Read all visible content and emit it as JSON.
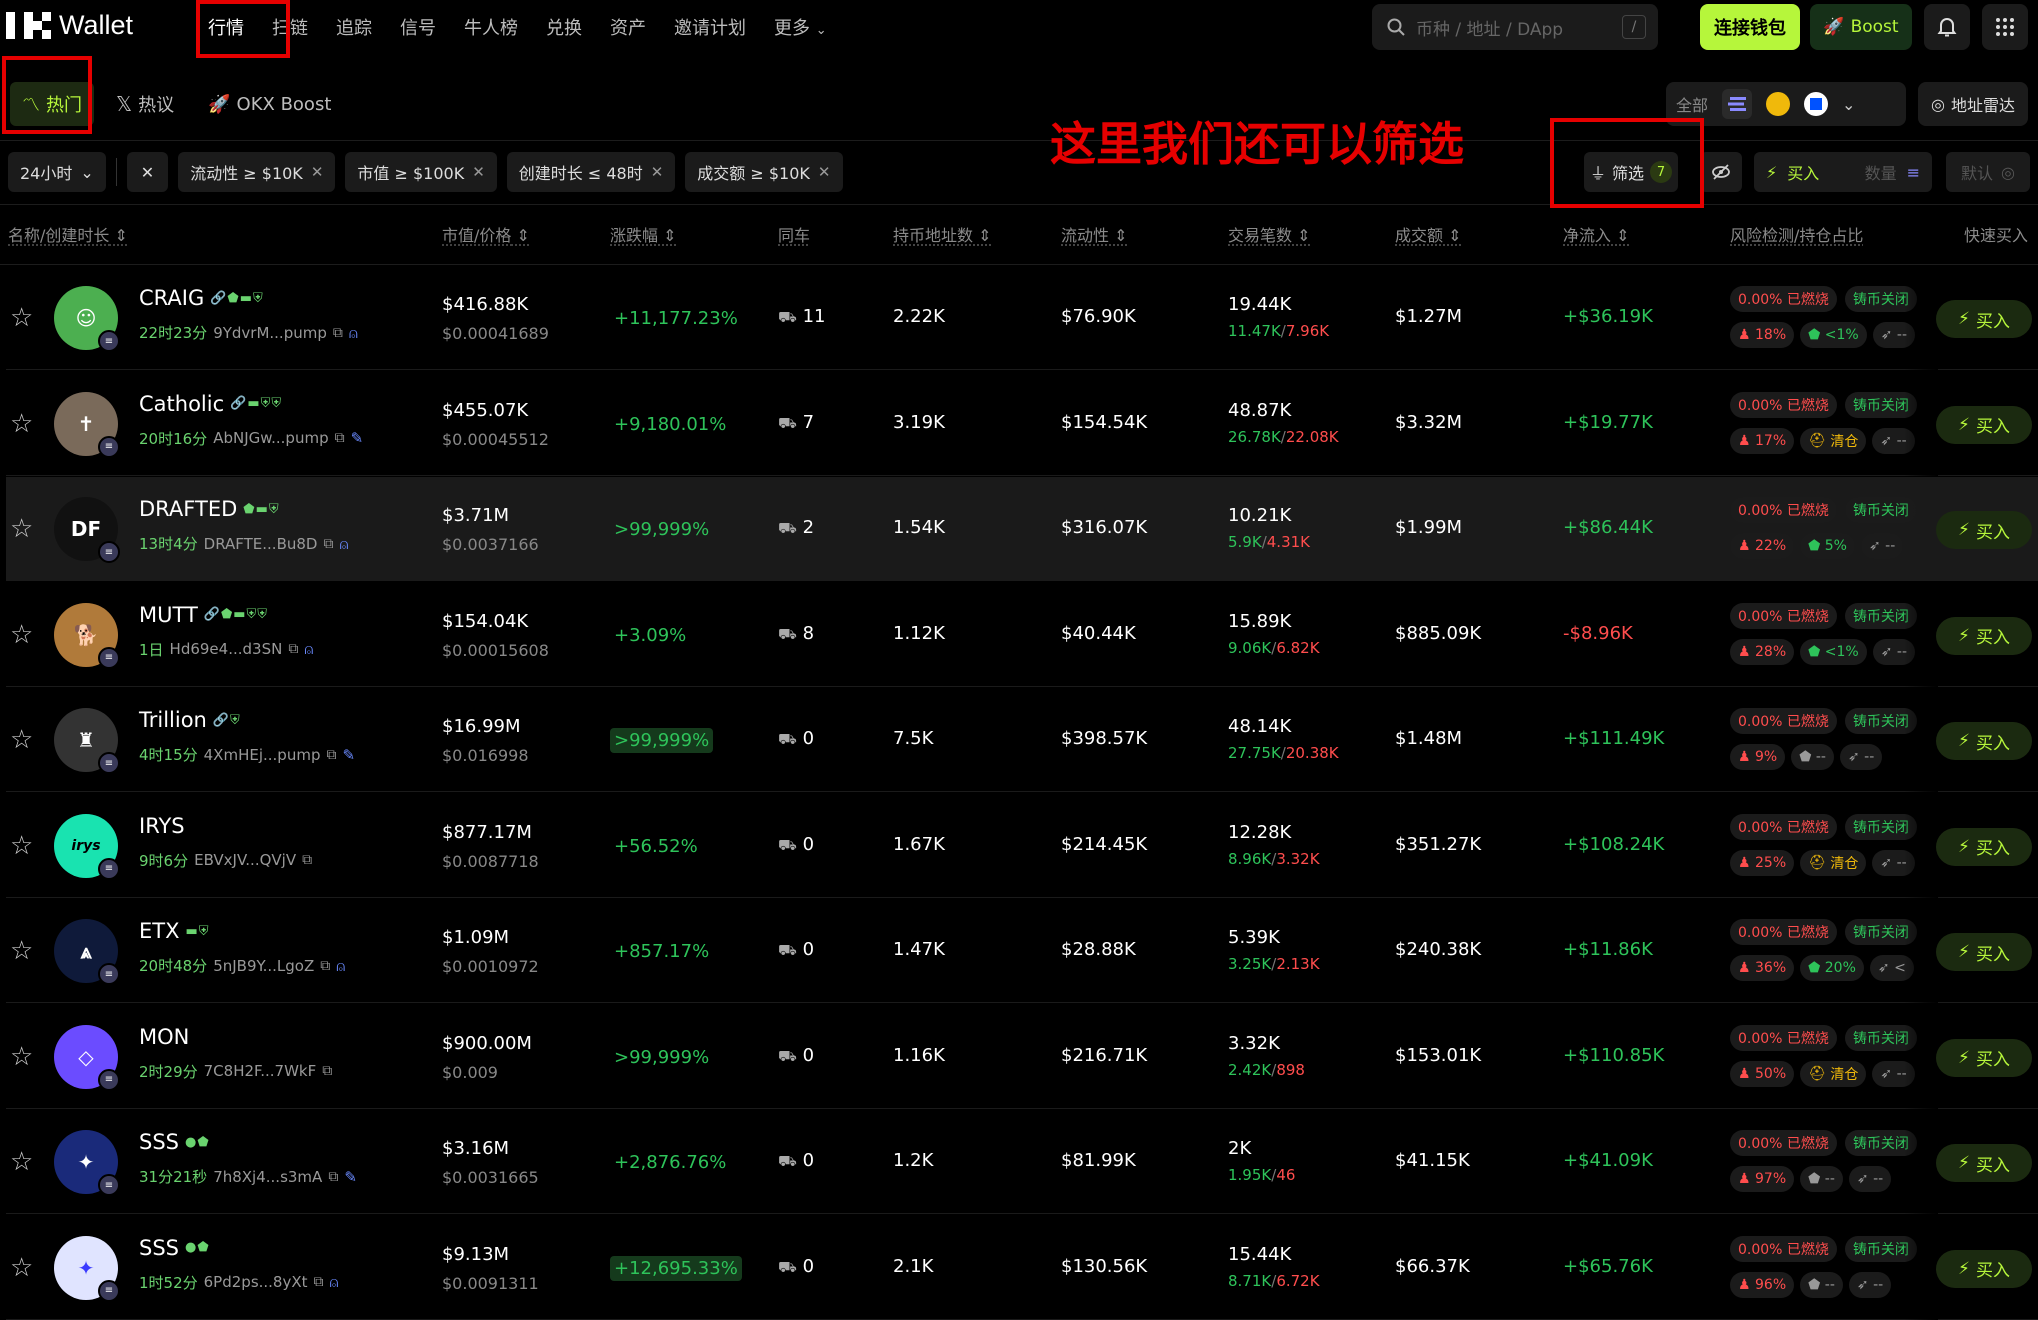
{
  "brand": {
    "wallet_label": "Wallet"
  },
  "nav": {
    "items": [
      "行情",
      "扫链",
      "追踪",
      "信号",
      "牛人榜",
      "兑换",
      "资产",
      "邀请计划",
      "更多"
    ],
    "more_icon": "chevron-down-icon"
  },
  "search": {
    "placeholder": "币种 / 地址 / DApp",
    "shortcut": "/"
  },
  "header_buttons": {
    "connect": "连接钱包",
    "boost": "Boost"
  },
  "subtabs": [
    {
      "label": "热门",
      "icon": "chart-icon"
    },
    {
      "label": "热议",
      "icon": "x-logo-icon"
    },
    {
      "label": "OKX Boost",
      "icon": "rocket-icon"
    }
  ],
  "chain_filter": {
    "all": "全部"
  },
  "radar": {
    "label": "地址雷达"
  },
  "annotation": "这里我们还可以筛选",
  "filters": {
    "timeframe": "24小时",
    "chips": [
      "流动性 ≥ $10K",
      "市值 ≥ $100K",
      "创建时长 ≤ 48时",
      "成交额 ≥ $10K"
    ],
    "filter_label": "筛选",
    "filter_count": "7",
    "quick_buy": "买入",
    "amount_placeholder": "数量",
    "default_label": "默认"
  },
  "columns": {
    "name": "名称/创建时长",
    "mcap": "市值/价格",
    "change": "涨跌幅",
    "same_car": "同车",
    "holders": "持币地址数",
    "liquidity": "流动性",
    "txs": "交易笔数",
    "volume": "成交额",
    "netflow": "净流入",
    "risk": "风险检测/持仓占比",
    "quickbuy": "快速买入"
  },
  "colors": {
    "accent": "#b6f63b",
    "up": "#2ec35a",
    "down": "#ff4d4d",
    "annotation": "#e60000"
  },
  "rows": [
    {
      "name": "CRAIG",
      "tags": "🔗⬟▬⛨",
      "age": "22时23分",
      "addr": "9YdvrM...pump",
      "social": "person-icon",
      "mcap": "$416.88K",
      "price": "$0.00041689",
      "change": "+11,177.23%",
      "same": "11",
      "holders": "2.22K",
      "liq": "$76.90K",
      "txs": "19.44K",
      "buys": "11.47K",
      "sells": "7.96K",
      "vol": "$1.27M",
      "net": "+$36.19K",
      "burn": "0.00% 已燃烧",
      "mint": "铸币关闭",
      "top": "18%",
      "b2": "<1%",
      "b3": "--"
    },
    {
      "name": "Catholic",
      "tags": "🔗▬⛨⛨",
      "age": "20时16分",
      "addr": "AbNJGw...pump",
      "social": "feather-icon",
      "mcap": "$455.07K",
      "price": "$0.00045512",
      "change": "+9,180.01%",
      "same": "7",
      "holders": "3.19K",
      "liq": "$154.54K",
      "txs": "48.87K",
      "buys": "26.78K",
      "sells": "22.08K",
      "vol": "$3.32M",
      "net": "+$19.77K",
      "burn": "0.00% 已燃烧",
      "mint": "铸币关闭",
      "top": "17%",
      "b2": "清仓",
      "b3": "--"
    },
    {
      "name": "DRAFTED",
      "tags": "⬟▬⛨",
      "age": "13时4分",
      "addr": "DRAFTE...Bu8D",
      "social": "person-icon",
      "mcap": "$3.71M",
      "price": "$0.0037166",
      "change": ">99,999%",
      "same": "2",
      "holders": "1.54K",
      "liq": "$316.07K",
      "txs": "10.21K",
      "buys": "5.9K",
      "sells": "4.31K",
      "vol": "$1.99M",
      "net": "+$86.44K",
      "burn": "0.00% 已燃烧",
      "mint": "铸币关闭",
      "top": "22%",
      "b2": "5%",
      "b3": "--"
    },
    {
      "name": "MUTT",
      "tags": "🔗⬟▬⛨⛨",
      "age": "1日",
      "addr": "Hd69e4...d3SN",
      "social": "person-icon",
      "mcap": "$154.04K",
      "price": "$0.00015608",
      "change": "+3.09%",
      "same": "8",
      "holders": "1.12K",
      "liq": "$40.44K",
      "txs": "15.89K",
      "buys": "9.06K",
      "sells": "6.82K",
      "vol": "$885.09K",
      "net": "-$8.96K",
      "burn": "0.00% 已燃烧",
      "mint": "铸币关闭",
      "top": "28%",
      "b2": "<1%",
      "b3": "--"
    },
    {
      "name": "Trillion",
      "tags": "🔗⛨",
      "age": "4时15分",
      "addr": "4XmHEj...pump",
      "social": "feather-icon",
      "mcap": "$16.99M",
      "price": "$0.016998",
      "change": ">99,999%",
      "same": "0",
      "holders": "7.5K",
      "liq": "$398.57K",
      "txs": "48.14K",
      "buys": "27.75K",
      "sells": "20.38K",
      "vol": "$1.48M",
      "net": "+$111.49K",
      "burn": "0.00% 已燃烧",
      "mint": "铸币关闭",
      "top": "9%",
      "b2": "--",
      "b3": "--"
    },
    {
      "name": "IRYS",
      "tags": "",
      "age": "9时6分",
      "addr": "EBVxJV...QVjV",
      "social": "",
      "mcap": "$877.17M",
      "price": "$0.0087718",
      "change": "+56.52%",
      "same": "0",
      "holders": "1.67K",
      "liq": "$214.45K",
      "txs": "12.28K",
      "buys": "8.96K",
      "sells": "3.32K",
      "vol": "$351.27K",
      "net": "+$108.24K",
      "burn": "0.00% 已燃烧",
      "mint": "铸币关闭",
      "top": "25%",
      "b2": "清仓",
      "b3": "--"
    },
    {
      "name": "ETX",
      "tags": "▬⛨",
      "age": "20时48分",
      "addr": "5nJB9Y...LgoZ",
      "social": "person-icon",
      "mcap": "$1.09M",
      "price": "$0.0010972",
      "change": "+857.17%",
      "same": "0",
      "holders": "1.47K",
      "liq": "$28.88K",
      "txs": "5.39K",
      "buys": "3.25K",
      "sells": "2.13K",
      "vol": "$240.38K",
      "net": "+$11.86K",
      "burn": "0.00% 已燃烧",
      "mint": "铸币关闭",
      "top": "36%",
      "b2": "20%",
      "b3": "<"
    },
    {
      "name": "MON",
      "tags": "",
      "age": "2时29分",
      "addr": "7C8H2F...7WkF",
      "social": "",
      "mcap": "$900.00M",
      "price": "$0.009",
      "change": ">99,999%",
      "same": "0",
      "holders": "1.16K",
      "liq": "$216.71K",
      "txs": "3.32K",
      "buys": "2.42K",
      "sells": "898",
      "vol": "$153.01K",
      "net": "+$110.85K",
      "burn": "0.00% 已燃烧",
      "mint": "铸币关闭",
      "top": "50%",
      "b2": "清仓",
      "b3": "--"
    },
    {
      "name": "SSS",
      "tags": "●⬟",
      "age": "31分21秒",
      "addr": "7h8Xj4...s3mA",
      "social": "feather-icon",
      "mcap": "$3.16M",
      "price": "$0.0031665",
      "change": "+2,876.76%",
      "same": "0",
      "holders": "1.2K",
      "liq": "$81.99K",
      "txs": "2K",
      "buys": "1.95K",
      "sells": "46",
      "vol": "$41.15K",
      "net": "+$41.09K",
      "burn": "0.00% 已燃烧",
      "mint": "铸币关闭",
      "top": "97%",
      "b2": "--",
      "b3": "--"
    },
    {
      "name": "SSS",
      "tags": "●⬟",
      "age": "1时52分",
      "addr": "6Pd2ps...8yXt",
      "social": "person-icon",
      "mcap": "$9.13M",
      "price": "$0.0091311",
      "change": "+12,695.33%",
      "same": "0",
      "holders": "2.1K",
      "liq": "$130.56K",
      "txs": "15.44K",
      "buys": "8.71K",
      "sells": "6.72K",
      "vol": "$66.37K",
      "net": "+$65.76K",
      "burn": "0.00% 已燃烧",
      "mint": "铸币关闭",
      "top": "96%",
      "b2": "--",
      "b3": "--"
    }
  ],
  "row_buy_label": "买入"
}
